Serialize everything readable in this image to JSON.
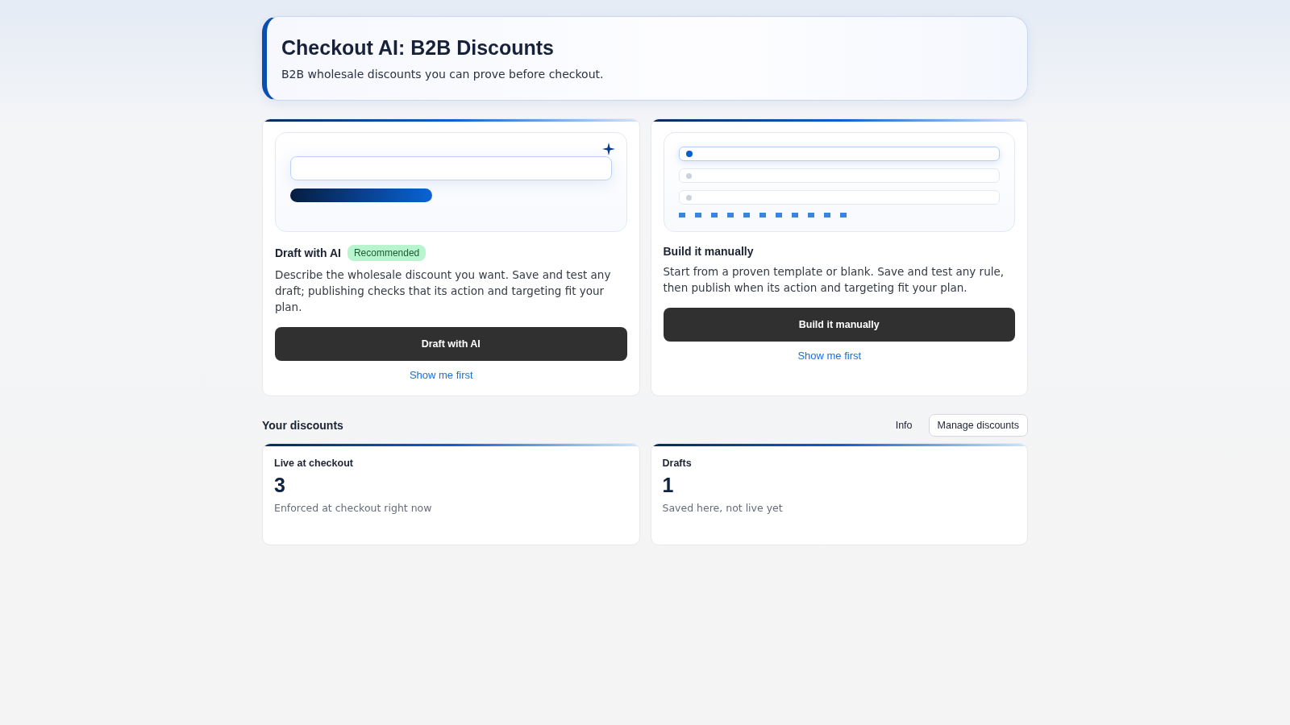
{
  "header": {
    "title": "Checkout AI: B2B Discounts",
    "subtitle": "B2B wholesale discounts you can prove before checkout."
  },
  "options": [
    {
      "kind": "ai",
      "title": "Draft with AI",
      "badge": "Recommended",
      "description": "Describe the wholesale discount you want. Save and test any draft; publishing checks that its action and targeting fit your plan.",
      "button": "Draft with AI",
      "link": "Show me first"
    },
    {
      "kind": "manual",
      "title": "Build it manually",
      "description": "Start from a proven template or blank. Save and test any rule, then publish when its action and targeting fit your plan.",
      "button": "Build it manually",
      "link": "Show me first"
    }
  ],
  "discounts": {
    "title": "Your discounts",
    "info": "Info",
    "manage": "Manage discounts",
    "stats": [
      {
        "label": "Live at checkout",
        "value": "3",
        "note": "Enforced at checkout right now"
      },
      {
        "label": "Drafts",
        "value": "1",
        "note": "Saved here, not live yet"
      }
    ]
  }
}
